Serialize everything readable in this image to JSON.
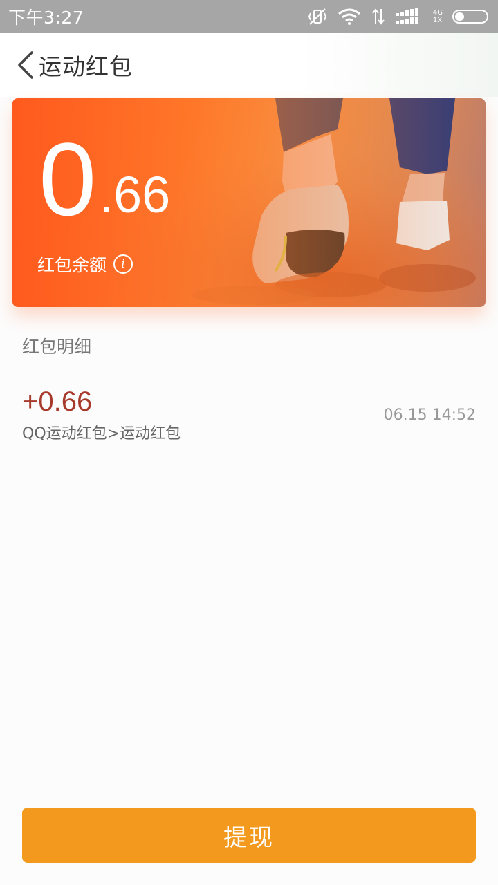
{
  "status_bar": {
    "time": "下午3:27",
    "network_top": "4G",
    "network_bottom": "1X",
    "icons": [
      "vibrate-off-icon",
      "wifi-icon",
      "data-arrows-icon",
      "signal-icon",
      "battery-icon"
    ]
  },
  "header": {
    "title": "运动红包",
    "back_icon": "chevron-left-icon"
  },
  "balance_card": {
    "amount_integer": "0",
    "amount_decimal": ".66",
    "label": "红包余额",
    "info_icon": "info-icon",
    "info_glyph": "i",
    "accent_color": "#ff5a1e"
  },
  "details": {
    "section_title": "红包明细",
    "records": [
      {
        "amount": "+0.66",
        "source": "QQ运动红包>运动红包",
        "time": "06.15 14:52"
      }
    ]
  },
  "withdraw_button": {
    "label": "提现",
    "color": "#f39a1e"
  }
}
